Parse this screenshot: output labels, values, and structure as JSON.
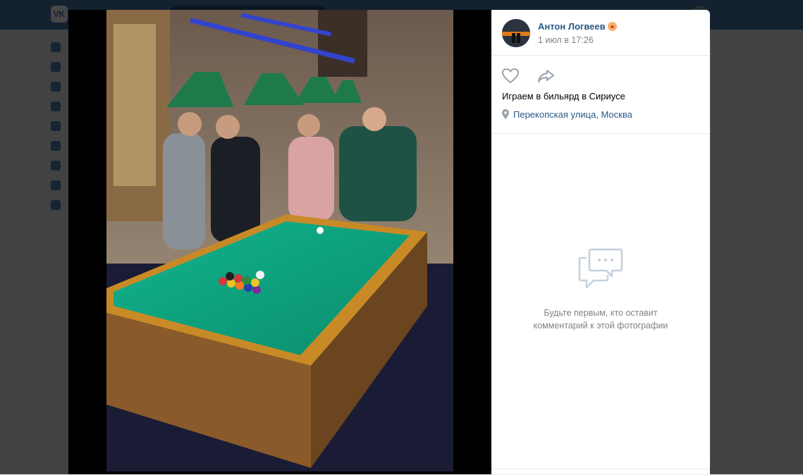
{
  "header": {
    "logo_text": "VK"
  },
  "viewer": {
    "photo": {
      "description_icon": "billiards-photo"
    },
    "author": {
      "name": "Антон Логвеев",
      "date": "1 июл в 17:26"
    },
    "actions": {
      "like_icon": "heart-icon",
      "share_icon": "share-icon"
    },
    "caption": "Играем в бильярд в Сириусе",
    "location": "Перекопская улица, Москва",
    "comments": {
      "empty_line1": "Будьте первым, кто оставит",
      "empty_line2": "комментарий к этой фотографии"
    }
  },
  "colors": {
    "vk_blue": "#4a76a8",
    "link": "#2a5885",
    "muted": "#828282",
    "table_felt": "#0c9a78"
  }
}
